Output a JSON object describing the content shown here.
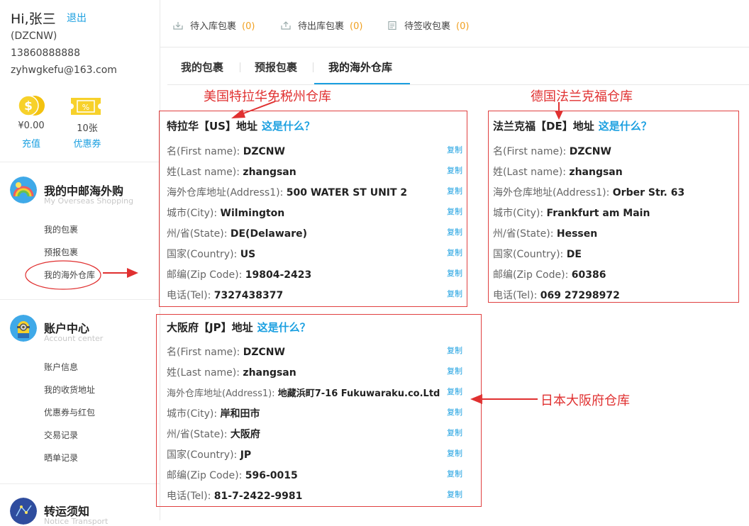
{
  "user": {
    "greeting": "Hi,张三",
    "logout": "退出",
    "code": "(DZCNW)",
    "phone": "13860888888",
    "email": "zyhwgkefu@163.com"
  },
  "wallet": {
    "balance": "¥0.00",
    "recharge": "充值",
    "coupon_count": "10张",
    "coupon_label": "优惠券"
  },
  "sections": [
    {
      "title": "我的中邮海外购",
      "subtitle": "My Overseas Shopping",
      "items": [
        "我的包裹",
        "预报包裹",
        "我的海外仓库"
      ]
    },
    {
      "title": "账户中心",
      "subtitle": "Account center",
      "items": [
        "账户信息",
        "我的收货地址",
        "优惠券与红包",
        "交易记录",
        "晒单记录"
      ]
    },
    {
      "title": "转运须知",
      "subtitle": "Notice Transport",
      "items": []
    }
  ],
  "status_bar": [
    {
      "label": "待入库包裹",
      "count": "(0)"
    },
    {
      "label": "待出库包裹",
      "count": "(0)"
    },
    {
      "label": "待签收包裹",
      "count": "(0)"
    }
  ],
  "tabs": [
    "我的包裹",
    "预报包裹",
    "我的海外仓库"
  ],
  "copy_label": "复制",
  "warehouses": [
    {
      "title": "特拉华【US】地址",
      "what": "这是什么？",
      "rows": [
        {
          "label": "名(First name):",
          "value": "DZCNW"
        },
        {
          "label": "姓(Last name):",
          "value": "zhangsan"
        },
        {
          "label": "海外仓库地址(Address1):",
          "value": "500 WATER ST UNIT 2"
        },
        {
          "label": "城市(City):",
          "value": "Wilmington"
        },
        {
          "label": "州/省(State):",
          "value": "DE(Delaware)"
        },
        {
          "label": "国家(Country):",
          "value": "US"
        },
        {
          "label": "邮编(Zip Code):",
          "value": "19804-2423"
        },
        {
          "label": "电话(Tel):",
          "value": "7327438377"
        }
      ]
    },
    {
      "title": "法兰克福【DE】地址",
      "what": "这是什么？",
      "rows": [
        {
          "label": "名(First name):",
          "value": "DZCNW"
        },
        {
          "label": "姓(Last name):",
          "value": "zhangsan"
        },
        {
          "label": "海外仓库地址(Address1):",
          "value": "Orber Str. 63"
        },
        {
          "label": "城市(City):",
          "value": "Frankfurt am Main"
        },
        {
          "label": "州/省(State):",
          "value": "Hessen"
        },
        {
          "label": "国家(Country):",
          "value": "DE"
        },
        {
          "label": "邮编(Zip Code):",
          "value": "60386"
        },
        {
          "label": "电话(Tel):",
          "value": "069 27298972"
        }
      ]
    },
    {
      "title": "大阪府【JP】地址",
      "what": "这是什么？",
      "rows": [
        {
          "label": "名(First name):",
          "value": "DZCNW"
        },
        {
          "label": "姓(Last name):",
          "value": "zhangsan"
        },
        {
          "label": "海外仓库地址(Address1):",
          "value": "地藏浜町7-16 Fukuwaraku.co.Ltd"
        },
        {
          "label": "城市(City):",
          "value": "岸和田市"
        },
        {
          "label": "州/省(State):",
          "value": "大阪府"
        },
        {
          "label": "国家(Country):",
          "value": "JP"
        },
        {
          "label": "邮编(Zip Code):",
          "value": "596-0015"
        },
        {
          "label": "电话(Tel):",
          "value": "81-7-2422-9981"
        }
      ]
    }
  ],
  "annotations": {
    "us": "美国特拉华免税州仓库",
    "de": "德国法兰克福仓库",
    "jp": "日本大阪府仓库"
  },
  "colors": {
    "accent": "#1a9fe0",
    "annotation": "#e03030",
    "count": "#f0a020"
  }
}
